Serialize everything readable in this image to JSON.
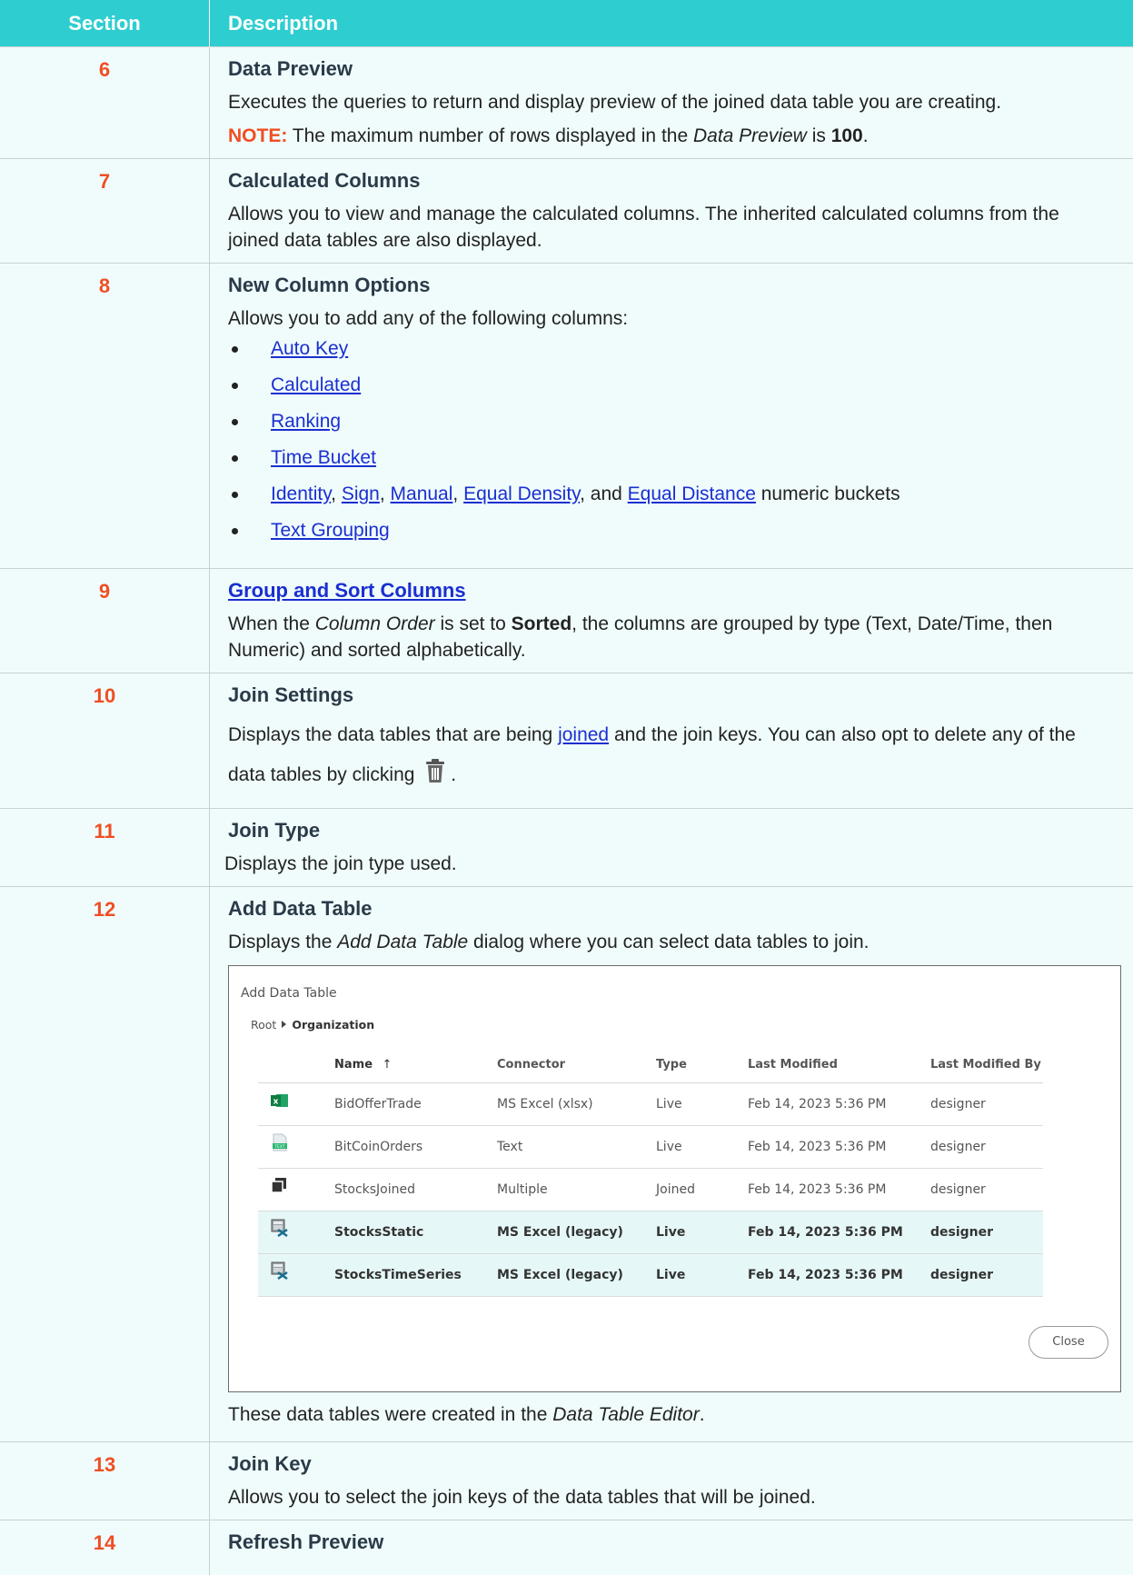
{
  "header": {
    "section": "Section",
    "description": "Description"
  },
  "rows": [
    {
      "num": "6",
      "title": "Data Preview",
      "text": "Executes the queries to return and display preview of the joined data table you are creating.",
      "note_label": "NOTE:",
      "note_a": " The maximum number of rows displayed in the ",
      "note_em": "Data Preview",
      "note_b": " is ",
      "note_strong": "100",
      "note_c": "."
    },
    {
      "num": "7",
      "title": "Calculated Columns",
      "text": "Allows you to view and manage the calculated columns. The inherited calculated columns from the joined data tables are also displayed."
    },
    {
      "num": "8",
      "title": "New Column Options",
      "text": "Allows you to add any of the following columns:",
      "items": [
        "Auto Key",
        "Calculated",
        "Ranking",
        "Time Bucket"
      ],
      "bucket_links": [
        "Identity",
        "Sign",
        "Manual",
        "Equal Density",
        "Equal Distance"
      ],
      "bucket_sep": ", ",
      "bucket_and": ", and ",
      "bucket_suffix": " numeric buckets",
      "last_item": "Text Grouping"
    },
    {
      "num": "9",
      "title": "Group and Sort Columns",
      "text_a": "When the ",
      "text_em": "Column Order",
      "text_b": " is set to ",
      "text_strong": "Sorted",
      "text_c": ", the columns are grouped by type (Text, Date/Time, then Numeric) and sorted alphabetically."
    },
    {
      "num": "10",
      "title": "Join Settings",
      "text_a": "Displays the data tables that are being ",
      "text_link": "joined",
      "text_b": " and the join keys. You can also opt to delete any of the data tables by clicking ",
      "text_c": "."
    },
    {
      "num": "11",
      "title": "Join Type",
      "text": "Displays the join type used."
    },
    {
      "num": "12",
      "title": "Add Data Table",
      "text_a": "Displays the ",
      "text_em": "Add Data Table",
      "text_b": " dialog where you can select data tables to join.",
      "after_a": "These data tables were created in the ",
      "after_em": "Data Table Editor",
      "after_b": "."
    },
    {
      "num": "13",
      "title": "Join Key",
      "text": "Allows you to select the join keys of the data tables that will be joined."
    },
    {
      "num": "14",
      "title": "Refresh Preview"
    }
  ],
  "dialog": {
    "title": "Add Data Table",
    "crumb_root": "Root",
    "crumb_current": "Organization",
    "columns": [
      "Name",
      "Connector",
      "Type",
      "Last Modified",
      "Last Modified By"
    ],
    "sort_arrow": "↑",
    "close_label": "Close",
    "rows": [
      {
        "icon": "excel-icon",
        "name": "BidOfferTrade",
        "connector": "MS Excel (xlsx)",
        "type": "Live",
        "modified": "Feb 14, 2023 5:36 PM",
        "by": "designer",
        "selected": false
      },
      {
        "icon": "text-file-icon",
        "name": "BitCoinOrders",
        "connector": "Text",
        "type": "Live",
        "modified": "Feb 14, 2023 5:36 PM",
        "by": "designer",
        "selected": false
      },
      {
        "icon": "joined-icon",
        "name": "StocksJoined",
        "connector": "Multiple",
        "type": "Joined",
        "modified": "Feb 14, 2023 5:36 PM",
        "by": "designer",
        "selected": false
      },
      {
        "icon": "excel-legacy-icon",
        "name": "StocksStatic",
        "connector": "MS Excel (legacy)",
        "type": "Live",
        "modified": "Feb 14, 2023 5:36 PM",
        "by": "designer",
        "selected": true
      },
      {
        "icon": "excel-legacy-icon",
        "name": "StocksTimeSeries",
        "connector": "MS Excel (legacy)",
        "type": "Live",
        "modified": "Feb 14, 2023 5:36 PM",
        "by": "designer",
        "selected": true
      }
    ]
  },
  "colors": {
    "header_bg": "#2ecdd0",
    "row_bg": "#f0fcfc",
    "number": "#f04e23",
    "title": "#2a3a48",
    "link": "#1a2fd0"
  }
}
